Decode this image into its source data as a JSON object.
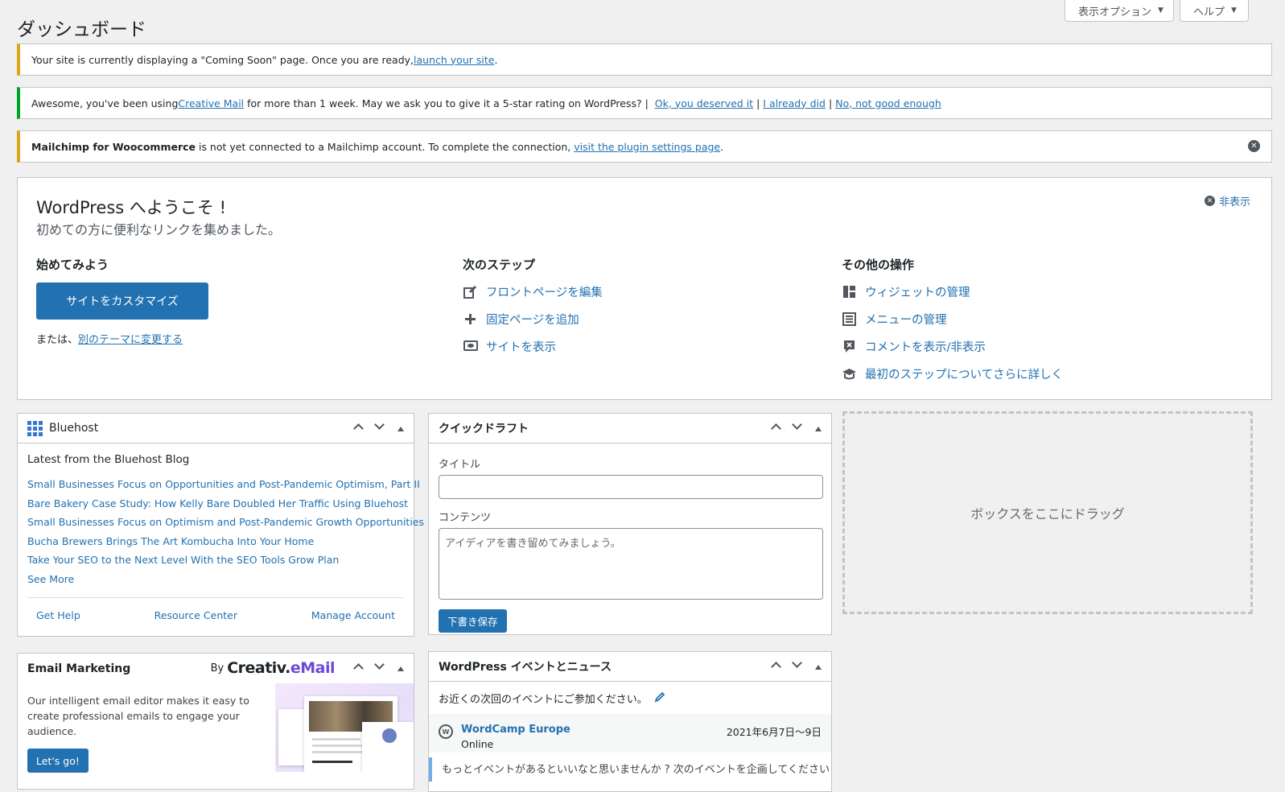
{
  "screen_meta": {
    "screen_options": "表示オプション",
    "help": "ヘルプ"
  },
  "page_title": "ダッシュボード",
  "notices": {
    "coming_soon": {
      "text": "Your site is currently displaying a \"Coming Soon\" page. Once you are ready, ",
      "link": "launch your site",
      "suffix": "."
    },
    "creative_mail": {
      "text_before": "Awesome, you've been using ",
      "link_brand": "Creative Mail",
      "text_after": " for more than 1 week. May we ask you to give it a 5-star rating on WordPress? | ",
      "link_yes": "Ok, you deserved it",
      "link_done": "I already did",
      "link_no": "No, not good enough",
      "sep": "|"
    },
    "mailchimp": {
      "bold": "Mailchimp for Woocommerce",
      "text": " is not yet connected to a Mailchimp account. To complete the connection, ",
      "link": "visit the plugin settings page",
      "suffix": "."
    }
  },
  "welcome": {
    "title": "WordPress へようこそ !",
    "about": "初めての方に便利なリンクを集めました。",
    "hide": "非表示",
    "col1": {
      "heading": "始めてみよう",
      "customize_button": "サイトをカスタマイズ",
      "alt_prefix": "または、",
      "alt_link": "別のテーマに変更する"
    },
    "col2": {
      "heading": "次のステップ",
      "links": [
        "フロントページを編集",
        "固定ページを追加",
        "サイトを表示"
      ]
    },
    "col3": {
      "heading": "その他の操作",
      "links": [
        "ウィジェットの管理",
        "メニューの管理",
        "コメントを表示/非表示",
        "最初のステップについてさらに詳しく"
      ]
    }
  },
  "bluehost": {
    "title": "Bluehost",
    "latest": "Latest from the Bluehost Blog",
    "posts": [
      "Small Businesses Focus on Opportunities and Post-Pandemic Optimism, Part II",
      "Bare Bakery Case Study: How Kelly Bare Doubled Her Traffic Using Bluehost",
      "Small Businesses Focus on Optimism and Post-Pandemic Growth Opportunities",
      "Bucha Brewers Brings The Art Kombucha Into Your Home",
      "Take Your SEO to the Next Level With the SEO Tools Grow Plan"
    ],
    "see_more": "See More",
    "footer": [
      "Get Help",
      "Resource Center",
      "Manage Account"
    ]
  },
  "quick_draft": {
    "title": "クイックドラフト",
    "title_label": "タイトル",
    "content_label": "コンテンツ",
    "content_placeholder": "アイディアを書き留めてみましょう。",
    "save_button": "下書き保存"
  },
  "dropzone": "ボックスをここにドラッグ",
  "email_marketing": {
    "title": "Email Marketing",
    "by": "By",
    "brand_a": "Creativ.",
    "brand_b": "eMail",
    "description": "Our intelligent email editor makes it easy to create professional emails to engage your audience.",
    "cta": "Let's go!"
  },
  "events": {
    "title": "WordPress イベントとニュース",
    "intro": "お近くの次回のイベントにご参加ください。",
    "event_name": "WordCamp Europe",
    "event_type": "Online",
    "event_date": "2021年6月7日〜9日",
    "note": "もっとイベントがあるといいなと思いませんか ? 次のイベントを企画してください !"
  },
  "icons": {
    "edit": "edit-icon",
    "add": "plus-icon",
    "view": "view-icon",
    "widgets": "widgets-icon",
    "menus": "menu-icon",
    "comments": "comments-icon",
    "learn": "learn-more-icon"
  },
  "colors": {
    "accent": "#2271b1",
    "warning": "#dba617",
    "success": "#00a32a",
    "background": "#f0f0f1"
  }
}
